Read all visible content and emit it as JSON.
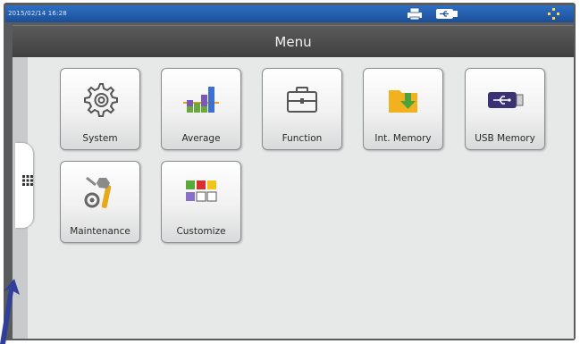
{
  "status_bar": {
    "datetime": "2015/02/14 16:28",
    "icons": [
      "printer-icon",
      "usb-icon",
      "network-icon"
    ]
  },
  "header": {
    "title": "Menu"
  },
  "menu": {
    "items": [
      {
        "label": "System",
        "icon": "gear-icon"
      },
      {
        "label": "Average",
        "icon": "bar-chart-icon"
      },
      {
        "label": "Function",
        "icon": "toolbox-icon"
      },
      {
        "label": "Int. Memory",
        "icon": "folder-download-icon"
      },
      {
        "label": "USB Memory",
        "icon": "usb-drive-icon"
      },
      {
        "label": "Maintenance",
        "icon": "tools-icon"
      },
      {
        "label": "Customize",
        "icon": "color-grid-icon"
      }
    ]
  },
  "side_tab": {
    "icon": "grid-menu-icon"
  },
  "colors": {
    "statusbar": "#1b4f99",
    "titlebar": "#444444",
    "content_bg": "#e7e8e8",
    "annotation_arrow": "#2f3f9a"
  }
}
